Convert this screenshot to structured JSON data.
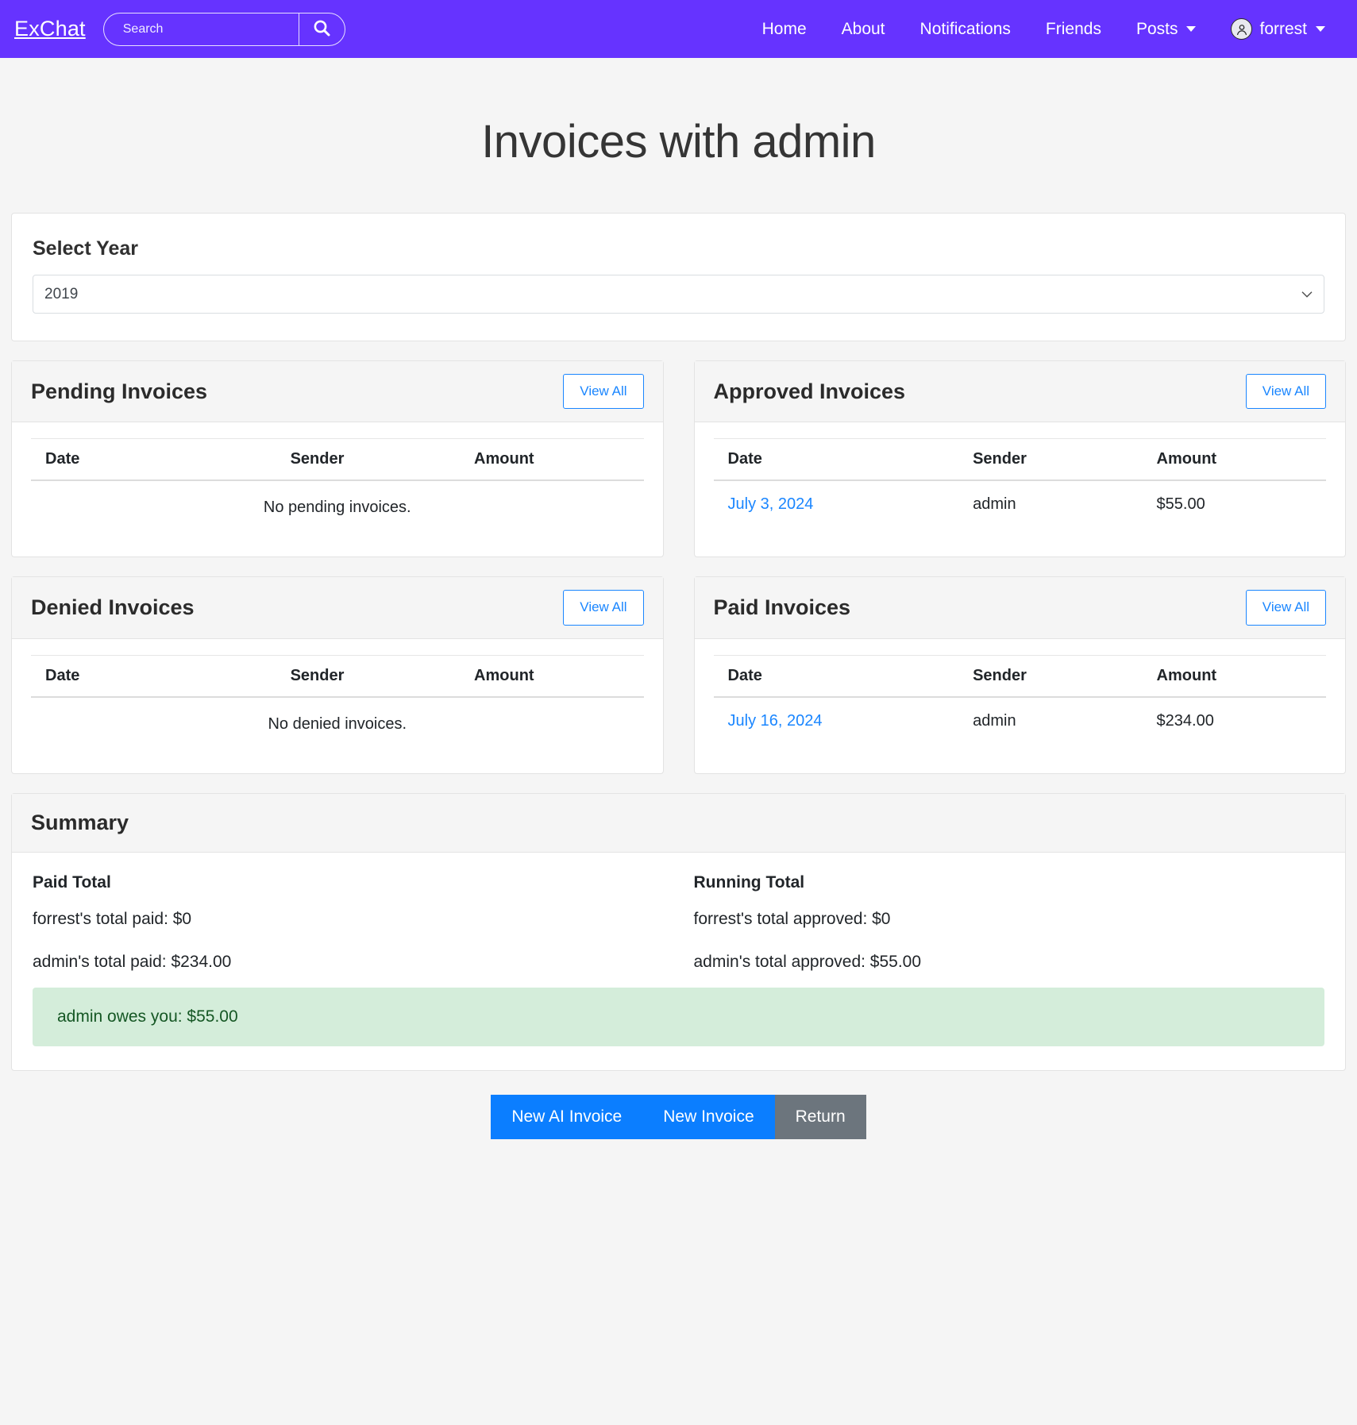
{
  "navbar": {
    "brand": "ExChat",
    "search": {
      "placeholder": "Search",
      "value": "",
      "icon": "search-icon"
    },
    "links": [
      {
        "label": "Home"
      },
      {
        "label": "About"
      },
      {
        "label": "Notifications"
      },
      {
        "label": "Friends"
      },
      {
        "label": "Posts",
        "caret": true
      },
      {
        "label": "forrest",
        "caret": true,
        "avatar": "user-avatar-icon"
      }
    ],
    "brand_color": "#6633ff"
  },
  "page": {
    "title": "Invoices with admin"
  },
  "year_card": {
    "label": "Select Year",
    "selected": "2019",
    "options": [
      "2019"
    ]
  },
  "columns": [
    "Date",
    "Sender",
    "Amount"
  ],
  "view_all_label": "View All",
  "cards": [
    {
      "id": "pending",
      "title": "Pending Invoices",
      "empty_text": "No pending invoices.",
      "rows": []
    },
    {
      "id": "approved",
      "title": "Approved Invoices",
      "empty_text": "",
      "rows": [
        {
          "date": "July 3, 2024",
          "sender": "admin",
          "amount": "$55.00"
        }
      ]
    },
    {
      "id": "denied",
      "title": "Denied Invoices",
      "empty_text": "No denied invoices.",
      "rows": []
    },
    {
      "id": "paid",
      "title": "Paid Invoices",
      "empty_text": "",
      "rows": [
        {
          "date": "July 16, 2024",
          "sender": "admin",
          "amount": "$234.00"
        }
      ]
    }
  ],
  "summary": {
    "title": "Summary",
    "paid": {
      "heading": "Paid Total",
      "line1": "forrest's total paid: $0",
      "line2": "admin's total paid: $234.00"
    },
    "running": {
      "heading": "Running Total",
      "line1": "forrest's total approved: $0",
      "line2": "admin's total approved: $55.00"
    },
    "alert": "admin owes you: $55.00",
    "alert_bg": "#d4edda",
    "alert_color": "#155724"
  },
  "footer_buttons": [
    {
      "label": "New AI Invoice",
      "style": "primary"
    },
    {
      "label": "New Invoice",
      "style": "primary"
    },
    {
      "label": "Return",
      "style": "secondary"
    }
  ]
}
